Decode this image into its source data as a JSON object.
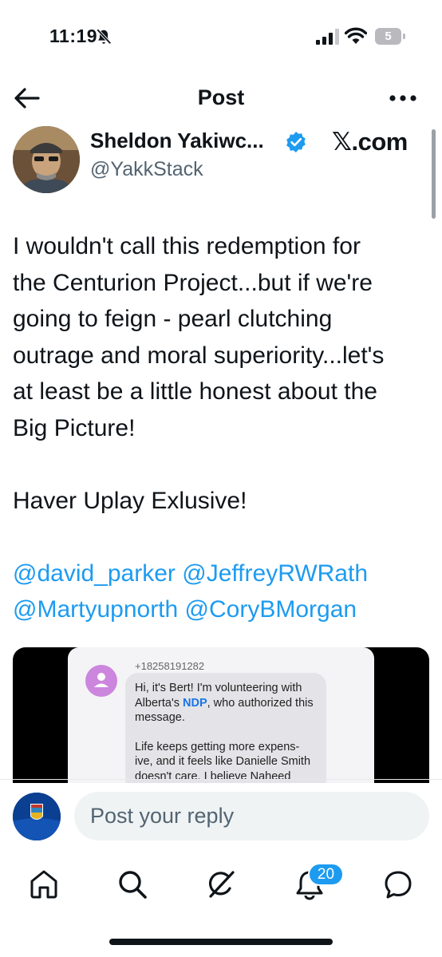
{
  "status_bar": {
    "time": "11:19",
    "battery": "5",
    "icons": [
      "bell-slash-icon",
      "signal-icon",
      "wifi-icon",
      "battery-icon"
    ]
  },
  "header": {
    "back_icon": "arrow-left-icon",
    "title": "Post",
    "more_icon": "more-horizontal-icon"
  },
  "author": {
    "name": "Sheldon Yakiwc...",
    "verified": true,
    "handle": "@YakkStack"
  },
  "watermark": "𝕏.com",
  "post": {
    "lines": [
      "I wouldn't call this redemption for",
      "the Centurion Project...but if we're",
      "going to feign - pearl clutching",
      "outrage and moral superiority...let's",
      "at least be a little honest about the",
      "Big Picture!"
    ],
    "line2": "Haver Uplay Exlusive!",
    "mentions": [
      "@david_parker",
      "@JeffreyRWRath",
      "@Martyupnorth",
      "@CoryBMorgan"
    ]
  },
  "media": {
    "sms_number": "+18258191282",
    "msg_part1": "Hi, it's Bert! I'm volunteering with Alberta's ",
    "msg_ndp": "NDP",
    "msg_part2": ", who authorized this message.",
    "msg_para2": "Life keeps getting more expens-ive, and it feels like Danielle Smith doesn't care. I believe Naheed"
  },
  "reply": {
    "placeholder": "Post your reply"
  },
  "bottom_nav": {
    "tabs": [
      "home-icon",
      "search-icon",
      "grok-icon",
      "notifications-icon",
      "messages-icon"
    ],
    "notification_count": "20"
  },
  "colors": {
    "accent": "#1d9bf0",
    "text": "#0f1419",
    "secondary": "#536471"
  }
}
